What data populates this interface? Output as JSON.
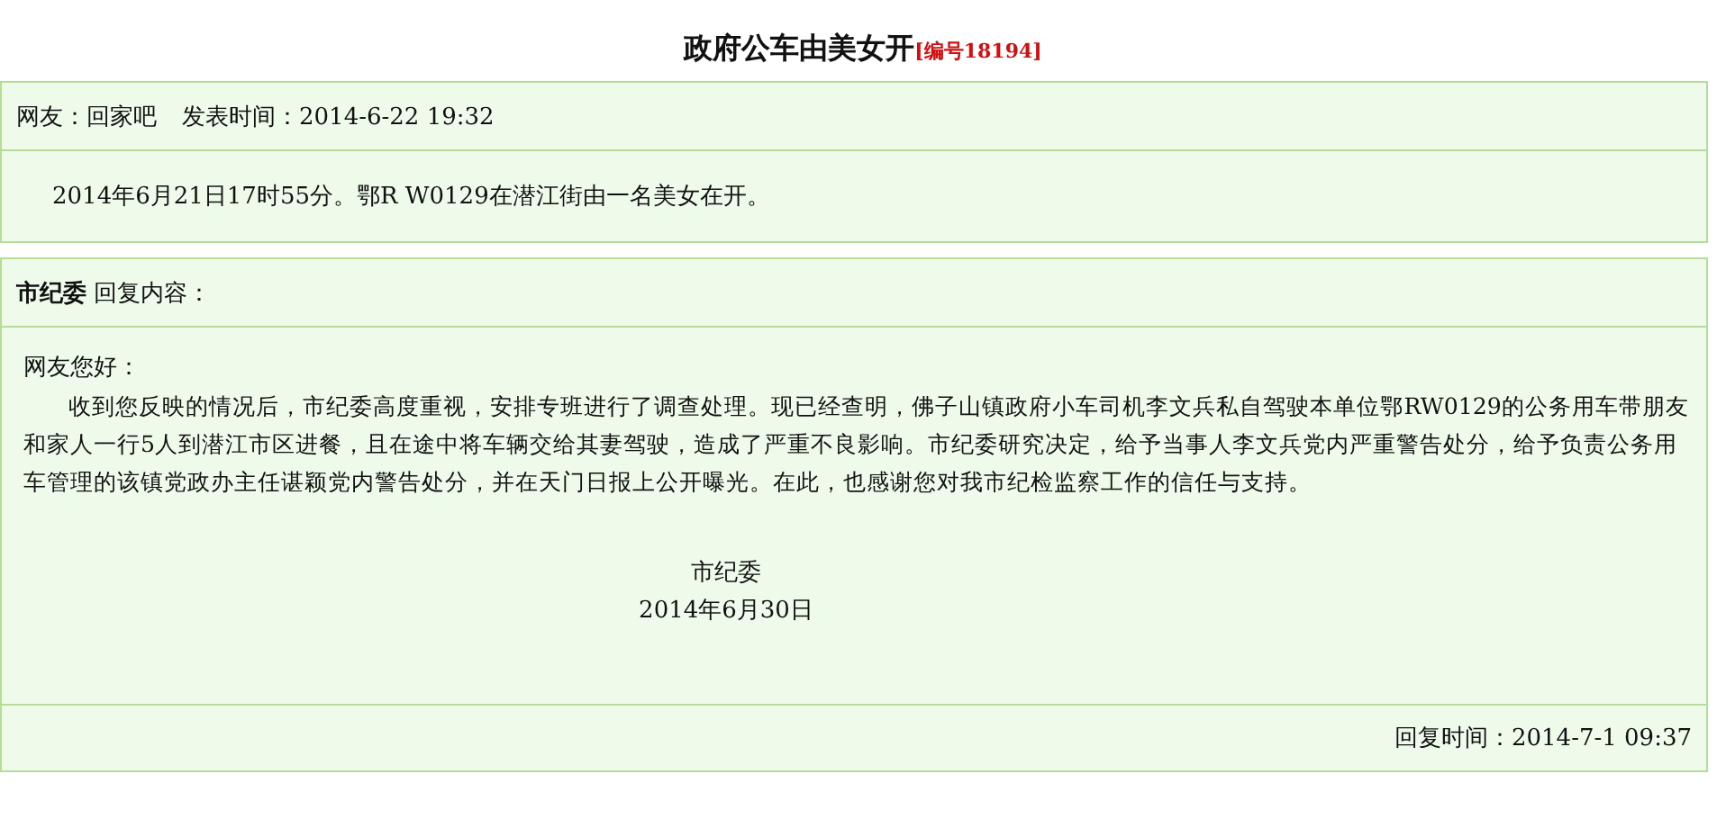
{
  "title": "政府公车由美女开",
  "serial": "[编号18194]",
  "post": {
    "author_label": "网友：回家吧",
    "time_label": "发表时间：2014-6-22 19:32",
    "content": "2014年6月21日17时55分。鄂R W0129在潜江街由一名美女在开。"
  },
  "reply": {
    "author": "市纪委",
    "header_label": "回复内容：",
    "greeting": "网友您好：",
    "body": "收到您反映的情况后，市纪委高度重视，安排专班进行了调查处理。现已经查明，佛子山镇政府小车司机李文兵私自驾驶本单位鄂RW0129的公务用车带朋友和家人一行5人到潜江市区进餐，且在途中将车辆交给其妻驾驶，造成了严重不良影响。市纪委研究决定，给予当事人李文兵党内严重警告处分，给予负责公务用车管理的该镇党政办主任谌颖党内警告处分，并在天门日报上公开曝光。在此，也感谢您对我市纪检监察工作的信任与支持。",
    "signature": "市纪委",
    "date": "2014年6月30日",
    "reply_time": "回复时间：2014-7-1 09:37"
  }
}
